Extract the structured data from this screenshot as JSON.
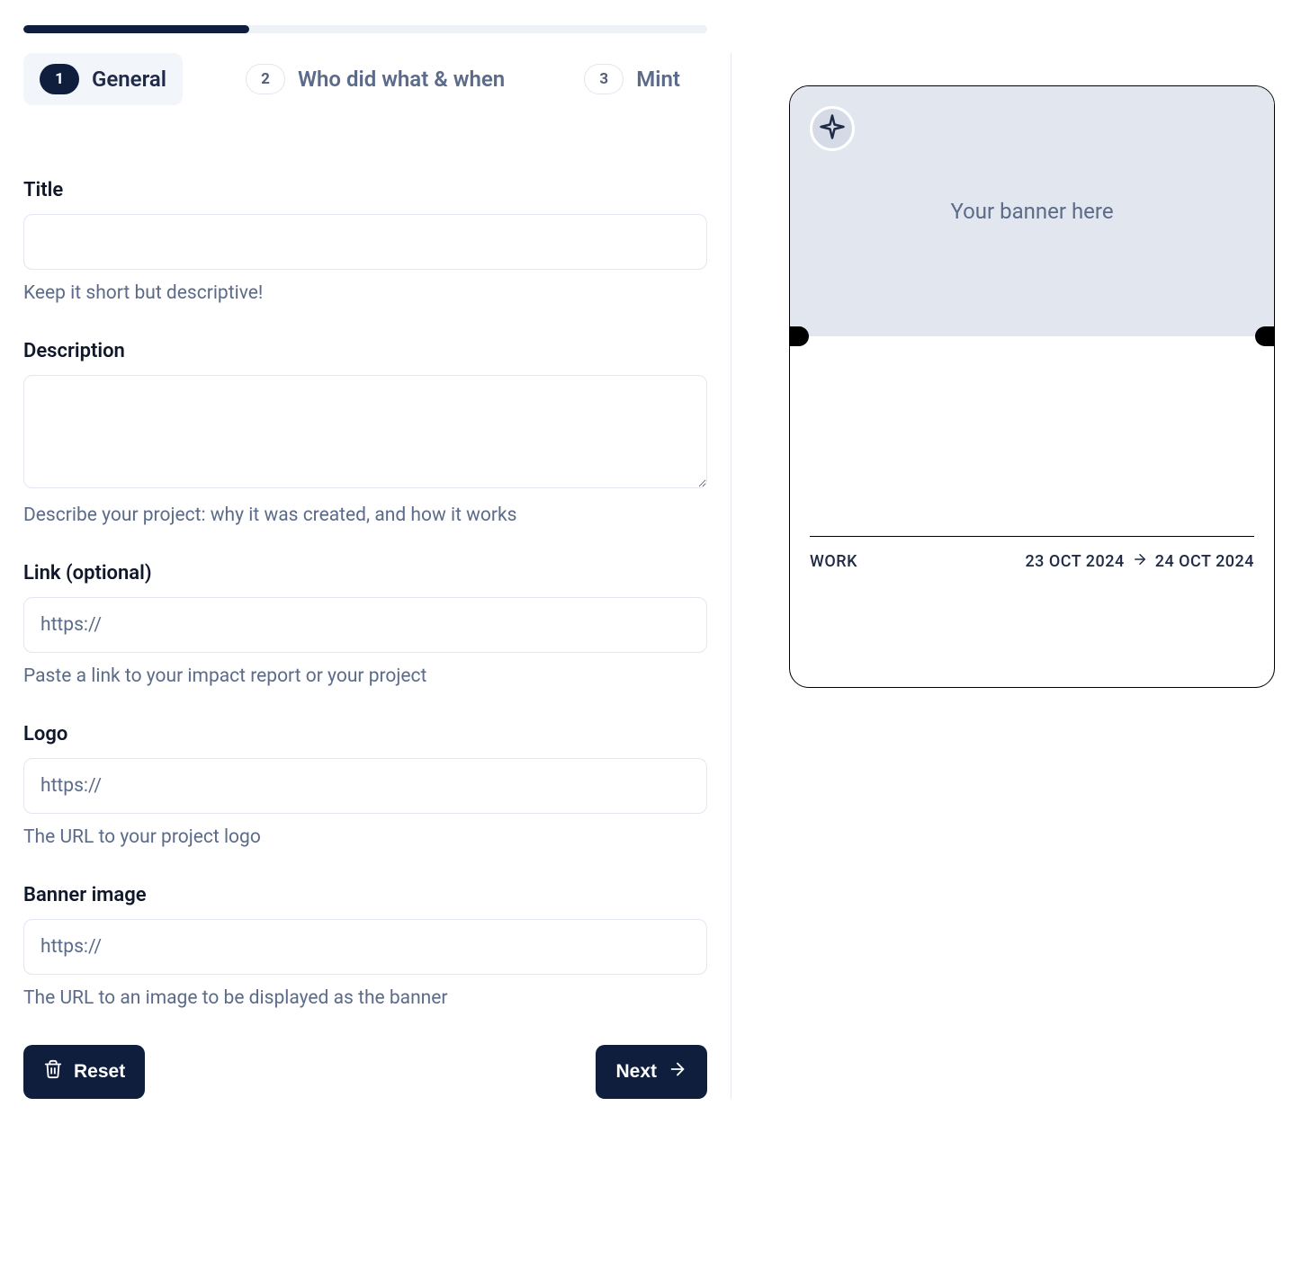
{
  "progress": {
    "percent": 33
  },
  "steps": [
    {
      "num": "1",
      "label": "General",
      "active": true
    },
    {
      "num": "2",
      "label": "Who did what & when",
      "active": false
    },
    {
      "num": "3",
      "label": "Mint",
      "active": false
    }
  ],
  "form": {
    "title": {
      "label": "Title",
      "value": "",
      "hint": "Keep it short but descriptive!"
    },
    "description": {
      "label": "Description",
      "value": "",
      "hint": "Describe your project: why it was created, and how it works"
    },
    "link": {
      "label": "Link (optional)",
      "placeholder": "https://",
      "value": "",
      "hint": "Paste a link to your impact report or your project"
    },
    "logo": {
      "label": "Logo",
      "placeholder": "https://",
      "value": "",
      "hint": "The URL to your project logo"
    },
    "banner": {
      "label": "Banner image",
      "placeholder": "https://",
      "value": "",
      "hint": "The URL to an image to be displayed as the banner"
    }
  },
  "buttons": {
    "reset": "Reset",
    "next": "Next"
  },
  "preview": {
    "banner_placeholder": "Your banner here",
    "tag": "WORK",
    "date_from": "23 OCT 2024",
    "date_to": "24 OCT 2024"
  }
}
